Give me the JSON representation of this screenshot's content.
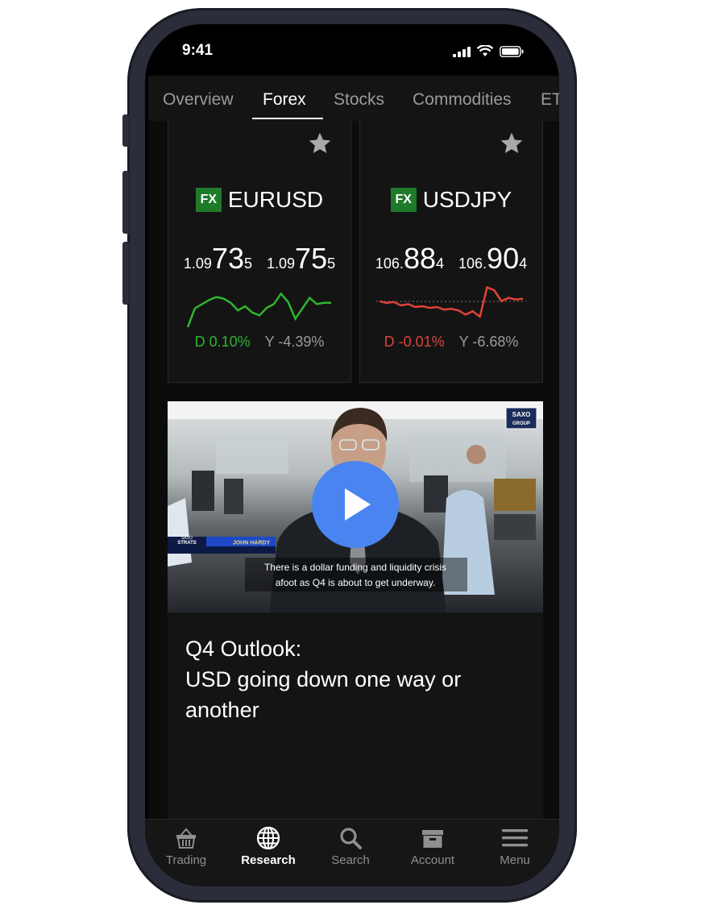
{
  "status": {
    "time": "9:41"
  },
  "tabs": [
    {
      "label": "Overview"
    },
    {
      "label": "Forex"
    },
    {
      "label": "Stocks"
    },
    {
      "label": "Commodities"
    },
    {
      "label": "ET"
    }
  ],
  "active_tab": "Forex",
  "cards": [
    {
      "badge": "FX",
      "symbol": "EURUSD",
      "bid": {
        "prefix": "1.09",
        "big": "73",
        "suffix": "5"
      },
      "ask": {
        "prefix": "1.09",
        "big": "75",
        "suffix": "5"
      },
      "day_change": "D 0.10%",
      "year_change": "Y -4.39%",
      "trend_color": "#2fb52f",
      "sparkline": [
        0.0,
        0.45,
        0.55,
        0.65,
        0.72,
        0.68,
        0.58,
        0.4,
        0.5,
        0.35,
        0.28,
        0.46,
        0.55,
        0.8,
        0.6,
        0.2,
        0.45,
        0.7,
        0.55,
        0.58,
        0.58
      ]
    },
    {
      "badge": "FX",
      "symbol": "USDJPY",
      "bid": {
        "prefix": "106.",
        "big": "88",
        "suffix": "4"
      },
      "ask": {
        "prefix": "106.",
        "big": "90",
        "suffix": "4"
      },
      "day_change": "D -0.01%",
      "year_change": "Y -6.68%",
      "trend_color": "#e0433a",
      "sparkline": [
        0.62,
        0.58,
        0.6,
        0.52,
        0.55,
        0.48,
        0.5,
        0.46,
        0.48,
        0.42,
        0.44,
        0.4,
        0.3,
        0.38,
        0.25,
        0.95,
        0.88,
        0.62,
        0.7,
        0.66,
        0.68
      ]
    }
  ],
  "video": {
    "logo_line1": "SAXO",
    "logo_line2": "GROUP",
    "lower_third_brand1": "SAXO",
    "lower_third_brand2": "STRATS",
    "presenter": "JOHN HARDY",
    "caption_line1": "There is a dollar funding and liquidity crisis",
    "caption_line2": "afoot as Q4 is about to get underway."
  },
  "article": {
    "headline_line1": "Q4 Outlook:",
    "headline_line2": "USD going down one way or",
    "headline_line3": "another"
  },
  "nav": [
    {
      "label": "Trading",
      "icon": "basket-icon"
    },
    {
      "label": "Research",
      "icon": "globe-icon"
    },
    {
      "label": "Search",
      "icon": "search-icon"
    },
    {
      "label": "Account",
      "icon": "account-box-icon"
    },
    {
      "label": "Menu",
      "icon": "menu-icon"
    }
  ],
  "colors": {
    "positive": "#2fb52f",
    "negative": "#e0433a",
    "fx_badge": "#1f7a2a",
    "play_button": "#4a84f0"
  }
}
